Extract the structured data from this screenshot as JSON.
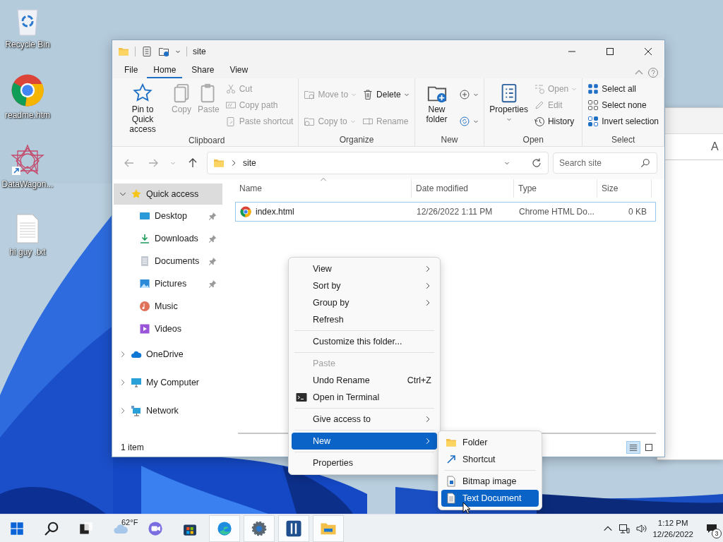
{
  "desktop_icons": [
    {
      "label": "Recycle Bin",
      "kind": "recycle"
    },
    {
      "label": "readme.htm",
      "kind": "chrome"
    },
    {
      "label": "DataWagon...",
      "kind": "app-shortcut"
    },
    {
      "label": "hi guy .txt",
      "kind": "text"
    }
  ],
  "background_window": {
    "text": "A"
  },
  "explorer": {
    "title": "site",
    "ribbon_tabs": [
      {
        "label": "File",
        "selected": false
      },
      {
        "label": "Home",
        "selected": true
      },
      {
        "label": "Share",
        "selected": false
      },
      {
        "label": "View",
        "selected": false
      }
    ],
    "ribbon_groups": [
      {
        "label": "Clipboard",
        "columns": [
          {
            "kind": "large",
            "items": [
              {
                "label": "Pin to Quick access",
                "kind": "star",
                "disabled": false
              }
            ]
          },
          {
            "kind": "large",
            "items": [
              {
                "label": "Copy",
                "kind": "copy",
                "disabled": true
              }
            ]
          },
          {
            "kind": "large",
            "items": [
              {
                "label": "Paste",
                "kind": "paste",
                "disabled": true
              }
            ]
          },
          {
            "kind": "small",
            "items": [
              {
                "label": "Cut",
                "kind": "cut",
                "disabled": true
              },
              {
                "label": "Copy path",
                "kind": "copy-path",
                "disabled": true
              },
              {
                "label": "Paste shortcut",
                "kind": "paste-shortcut",
                "disabled": true
              }
            ]
          }
        ]
      },
      {
        "label": "Organize",
        "columns": [
          {
            "kind": "small",
            "items": [
              {
                "label": "Move to",
                "kind": "move",
                "disabled": true,
                "dropdown": true
              },
              {
                "label": "Copy to",
                "kind": "copy-to",
                "disabled": true,
                "dropdown": true
              }
            ]
          },
          {
            "kind": "small",
            "items": [
              {
                "label": "Delete",
                "kind": "delete",
                "disabled": false,
                "dropdown": true
              },
              {
                "label": "Rename",
                "kind": "rename",
                "disabled": true
              }
            ]
          }
        ]
      },
      {
        "label": "New",
        "columns": [
          {
            "kind": "large",
            "items": [
              {
                "label": "New folder",
                "kind": "new-folder",
                "disabled": false
              }
            ]
          },
          {
            "kind": "small",
            "items": [
              {
                "kind": "new-item",
                "disabled": false,
                "dropdown": true
              },
              {
                "kind": "easy-access",
                "disabled": false,
                "dropdown": true
              }
            ]
          }
        ]
      },
      {
        "label": "Open",
        "columns": [
          {
            "kind": "large",
            "items": [
              {
                "label": "Properties",
                "kind": "properties",
                "disabled": false,
                "dropdown": true
              }
            ]
          },
          {
            "kind": "small",
            "items": [
              {
                "label": "Open",
                "kind": "open",
                "disabled": true,
                "dropdown": true
              },
              {
                "label": "Edit",
                "kind": "edit",
                "disabled": true
              },
              {
                "label": "History",
                "kind": "history",
                "disabled": false
              }
            ]
          }
        ]
      },
      {
        "label": "Select",
        "columns": [
          {
            "kind": "small",
            "items": [
              {
                "label": "Select all",
                "kind": "select-all",
                "disabled": false
              },
              {
                "label": "Select none",
                "kind": "select-none",
                "disabled": false
              },
              {
                "label": "Invert selection",
                "kind": "invert",
                "disabled": false
              }
            ]
          }
        ]
      }
    ],
    "address": {
      "path": "site"
    },
    "search": {
      "placeholder": "Search site"
    },
    "navigation": [
      {
        "label": "Quick access",
        "kind": "star",
        "expanded": true,
        "selected": true,
        "children": [
          {
            "label": "Desktop",
            "kind": "desktop",
            "pinned": true,
            "selected": false
          },
          {
            "label": "Downloads",
            "kind": "downloads",
            "pinned": true,
            "selected": false
          },
          {
            "label": "Documents",
            "kind": "documents",
            "pinned": true,
            "selected": false
          },
          {
            "label": "Pictures",
            "kind": "pictures",
            "pinned": true,
            "selected": false
          },
          {
            "label": "Music",
            "kind": "music",
            "pinned": false,
            "selected": false
          },
          {
            "label": "Videos",
            "kind": "videos",
            "pinned": false,
            "selected": false
          }
        ]
      },
      {
        "label": "OneDrive",
        "kind": "cloud",
        "expanded": false,
        "selected": false
      },
      {
        "label": "My Computer",
        "kind": "computer",
        "expanded": false,
        "selected": false
      },
      {
        "label": "Network",
        "kind": "network",
        "expanded": false,
        "selected": false
      }
    ],
    "table": {
      "columns": [
        "Name",
        "Date modified",
        "Type",
        "Size"
      ],
      "rows": [
        {
          "cells": [
            "index.html",
            "12/26/2022 1:11 PM",
            "Chrome HTML Do...",
            "0 KB"
          ],
          "focused": true
        }
      ]
    },
    "status_bar": {
      "text": "1 item",
      "views": [
        {
          "kind": "details",
          "selected": true
        },
        {
          "kind": "large-icons",
          "selected": false
        }
      ]
    }
  },
  "context_menu": [
    {
      "kind": "item",
      "label": "View",
      "submenu": true,
      "disabled": false,
      "selected": false
    },
    {
      "kind": "item",
      "label": "Sort by",
      "submenu": true,
      "disabled": false,
      "selected": false
    },
    {
      "kind": "item",
      "label": "Group by",
      "submenu": true,
      "disabled": false,
      "selected": false
    },
    {
      "kind": "item",
      "label": "Refresh",
      "submenu": false,
      "disabled": false,
      "selected": false
    },
    {
      "kind": "separator"
    },
    {
      "kind": "item",
      "label": "Customize this folder...",
      "submenu": false,
      "disabled": false,
      "selected": false
    },
    {
      "kind": "separator"
    },
    {
      "kind": "item",
      "label": "Paste",
      "submenu": false,
      "disabled": true,
      "selected": false
    },
    {
      "kind": "item",
      "label": "Undo Rename",
      "shortcut": "Ctrl+Z",
      "submenu": false,
      "disabled": false,
      "selected": false
    },
    {
      "kind": "terminal-item",
      "label": "Open in Terminal",
      "submenu": false,
      "disabled": false,
      "selected": false
    },
    {
      "kind": "separator"
    },
    {
      "kind": "item",
      "label": "Give access to",
      "submenu": true,
      "disabled": false,
      "selected": false
    },
    {
      "kind": "separator"
    },
    {
      "kind": "item",
      "label": "New",
      "submenu": true,
      "disabled": false,
      "selected": true
    },
    {
      "kind": "separator"
    },
    {
      "kind": "item",
      "label": "Properties",
      "submenu": false,
      "disabled": false,
      "selected": false
    }
  ],
  "new_submenu": [
    {
      "kind": "folder",
      "label": "Folder",
      "selected": false
    },
    {
      "kind": "shortcut",
      "label": "Shortcut",
      "selected": false
    },
    {
      "kind": "separator"
    },
    {
      "kind": "bitmap",
      "label": "Bitmap image",
      "selected": false
    },
    {
      "kind": "text",
      "label": "Text Document",
      "selected": true
    }
  ],
  "taskbar": {
    "apps": [
      {
        "kind": "start",
        "open": false
      },
      {
        "kind": "search",
        "open": false
      },
      {
        "kind": "task-view",
        "open": false
      },
      {
        "kind": "weather",
        "label": "62°F",
        "open": false
      },
      {
        "kind": "chat",
        "open": false
      },
      {
        "kind": "store",
        "open": false
      },
      {
        "kind": "edge",
        "open": true
      },
      {
        "kind": "settings",
        "open": true
      },
      {
        "kind": "app",
        "open": true
      },
      {
        "kind": "explorer",
        "open": true
      }
    ],
    "time": "1:12 PM",
    "date": "12/26/2022",
    "notifications": "3"
  }
}
